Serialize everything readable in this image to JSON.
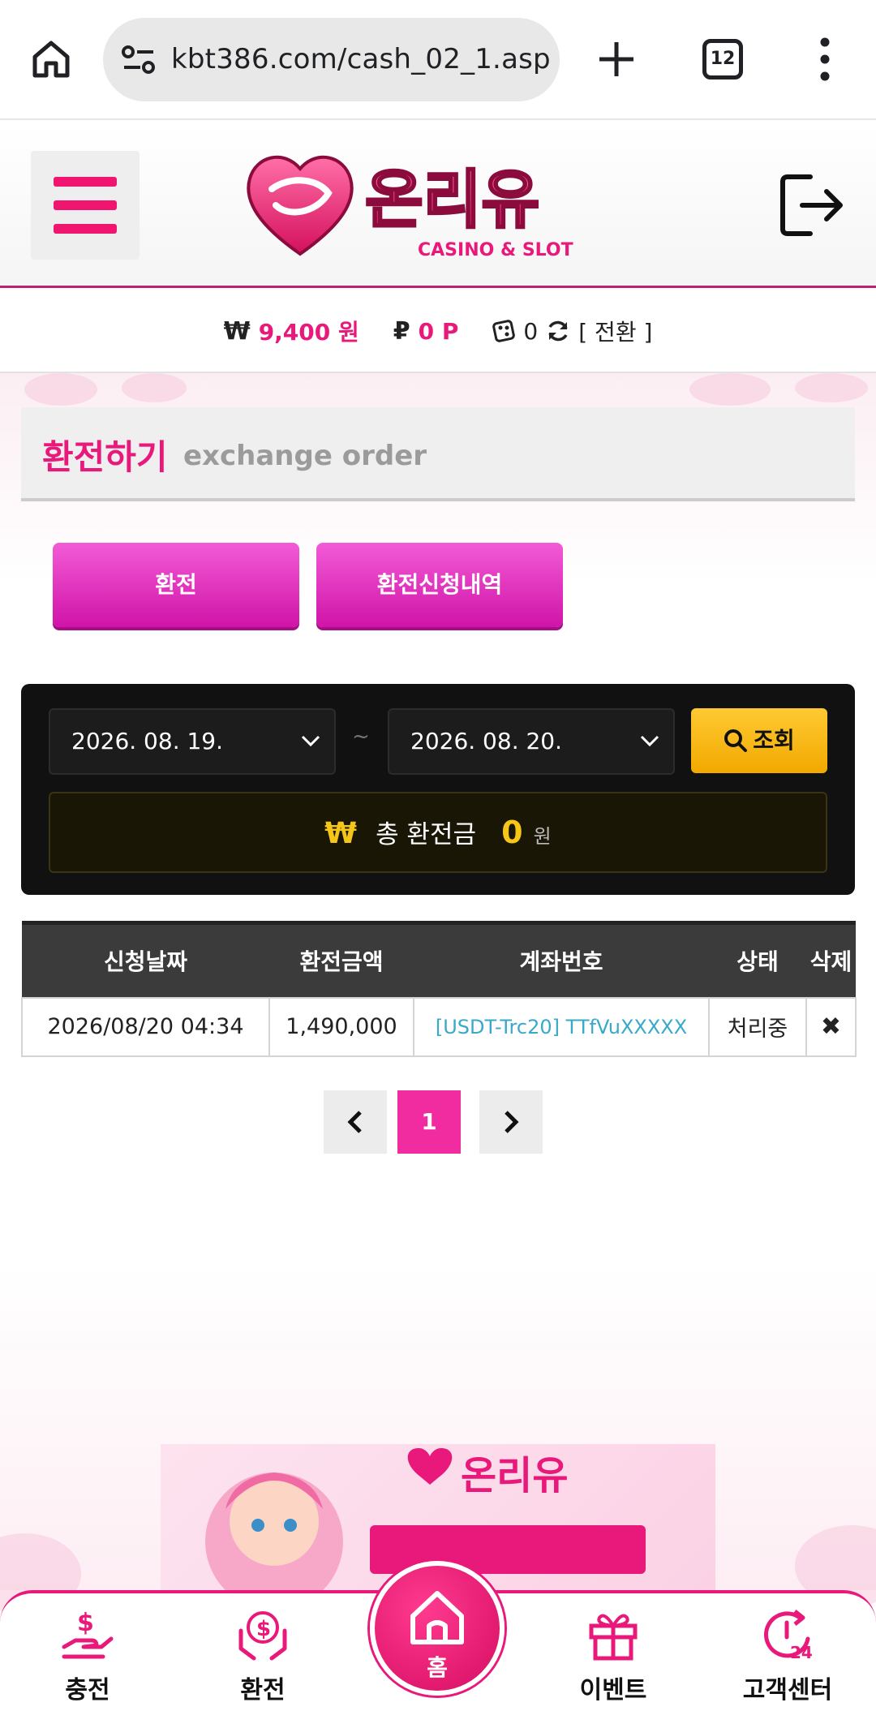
{
  "browser": {
    "url": "kbt386.com/cash_02_1.asp",
    "tab_count": "12"
  },
  "header": {
    "logo_text": "온리유",
    "logo_sub": "CASINO & SLOT"
  },
  "balance": {
    "money_symbol": "₩",
    "money_value": "9,400 원",
    "point_symbol": "₽",
    "point_value": "0 P",
    "chip_value": "0",
    "convert_label": "[ 전환 ]"
  },
  "title": {
    "korean": "환전하기",
    "english": "exchange order"
  },
  "tabs": [
    {
      "label": "환전"
    },
    {
      "label": "환전신청내역"
    }
  ],
  "search": {
    "start_date": "2026. 08. 19.",
    "end_date": "2026. 08. 20.",
    "separator": "~",
    "button_label": "조회"
  },
  "total": {
    "symbol": "₩",
    "label": "총 환전금",
    "value": "0",
    "unit": "원"
  },
  "table": {
    "headers": [
      "신청날짜",
      "환전금액",
      "계좌번호",
      "상태",
      "삭제"
    ],
    "rows": [
      {
        "date": "2026/08/20 04:34",
        "amount": "1,490,000",
        "account": "[USDT-Trc20] TTfVuXXXXX",
        "status": "처리중",
        "delete": "✖"
      }
    ]
  },
  "pagination": {
    "prev": "‹",
    "current": "1",
    "next": "›"
  },
  "bottom_nav": {
    "items": [
      {
        "label": "충전"
      },
      {
        "label": "환전"
      },
      {
        "label": "홈"
      },
      {
        "label": "이벤트"
      },
      {
        "label": "고객센터"
      }
    ]
  },
  "colors": {
    "accent": "#e8197a",
    "tab_gradient": "#e33bc4",
    "search_button": "#f5b800",
    "table_header": "#3b3b3b"
  }
}
